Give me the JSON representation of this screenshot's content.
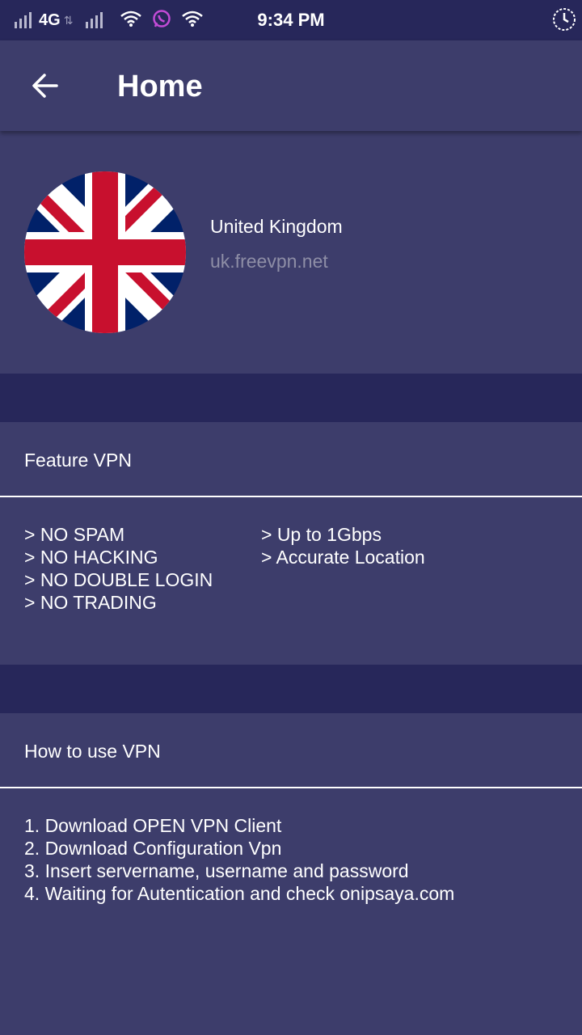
{
  "status_bar": {
    "network": "4G",
    "time": "9:34 PM",
    "icons": [
      "signal-icon",
      "data-arrows-icon",
      "signal-icon",
      "wifi-icon",
      "whatsapp-icon",
      "wifi-icon",
      "clock-icon"
    ]
  },
  "app_bar": {
    "back_icon": "arrow-left-icon",
    "title": "Home"
  },
  "server": {
    "country": "United Kingdom",
    "host": "uk.freevpn.net",
    "flag": "united-kingdom-flag"
  },
  "features": {
    "header": "Feature VPN",
    "left": [
      "> NO SPAM",
      "> NO HACKING",
      "> NO DOUBLE LOGIN",
      "> NO TRADING"
    ],
    "right": [
      "> Up to 1Gbps",
      "> Accurate Location"
    ]
  },
  "howto": {
    "header": "How to use VPN",
    "steps": [
      "1. Download OPEN VPN Client",
      "2. Download Configuration Vpn",
      "3. Insert servername, username and password",
      "4. Waiting for Autentication and check onipsaya.com"
    ]
  },
  "colors": {
    "background": "#3d3d6b",
    "status_bar": "#27275a",
    "divider": "#ffffff",
    "host_text": "#8e8ea6"
  }
}
